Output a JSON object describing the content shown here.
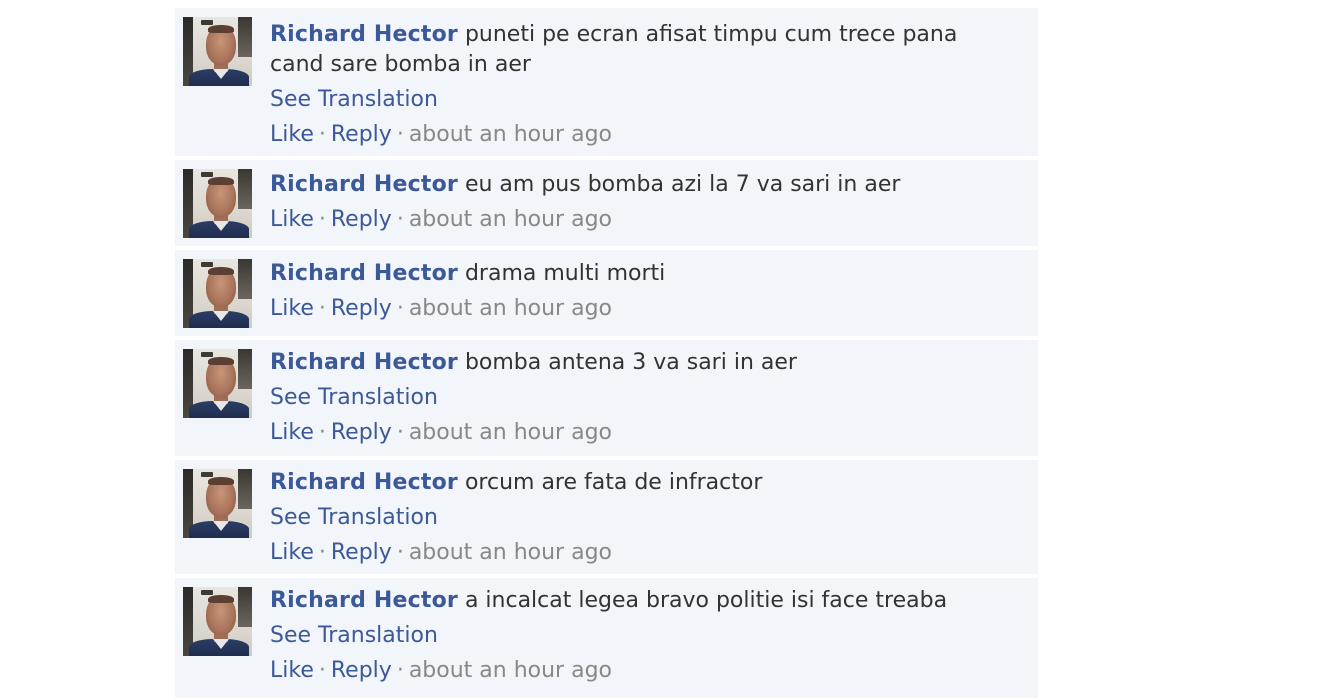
{
  "comments": [
    {
      "author": "Richard Hector",
      "text": "puneti pe ecran afisat timpu cum trece pana cand sare bomba in aer",
      "see_translation": "See Translation",
      "like": "Like",
      "reply": "Reply",
      "time": "about an hour ago"
    },
    {
      "author": "Richard Hector",
      "text": "eu am pus bomba azi la 7 va sari in aer",
      "see_translation": "",
      "like": "Like",
      "reply": "Reply",
      "time": "about an hour ago"
    },
    {
      "author": "Richard Hector",
      "text": "drama multi morti",
      "see_translation": "",
      "like": "Like",
      "reply": "Reply",
      "time": "about an hour ago"
    },
    {
      "author": "Richard Hector",
      "text": "bomba antena 3 va sari in aer",
      "see_translation": "See Translation",
      "like": "Like",
      "reply": "Reply",
      "time": "about an hour ago"
    },
    {
      "author": "Richard Hector",
      "text": "orcum are fata de infractor",
      "see_translation": "See Translation",
      "like": "Like",
      "reply": "Reply",
      "time": "about an hour ago"
    },
    {
      "author": "Richard Hector",
      "text": "a incalcat legea bravo politie isi face treaba",
      "see_translation": "See Translation",
      "like": "Like",
      "reply": "Reply",
      "time": "about an hour ago"
    }
  ],
  "separator": "·",
  "colors": {
    "link": "#3b5998",
    "meta": "#888888",
    "text": "#333333",
    "comment_bg": "#f2f5fa"
  }
}
